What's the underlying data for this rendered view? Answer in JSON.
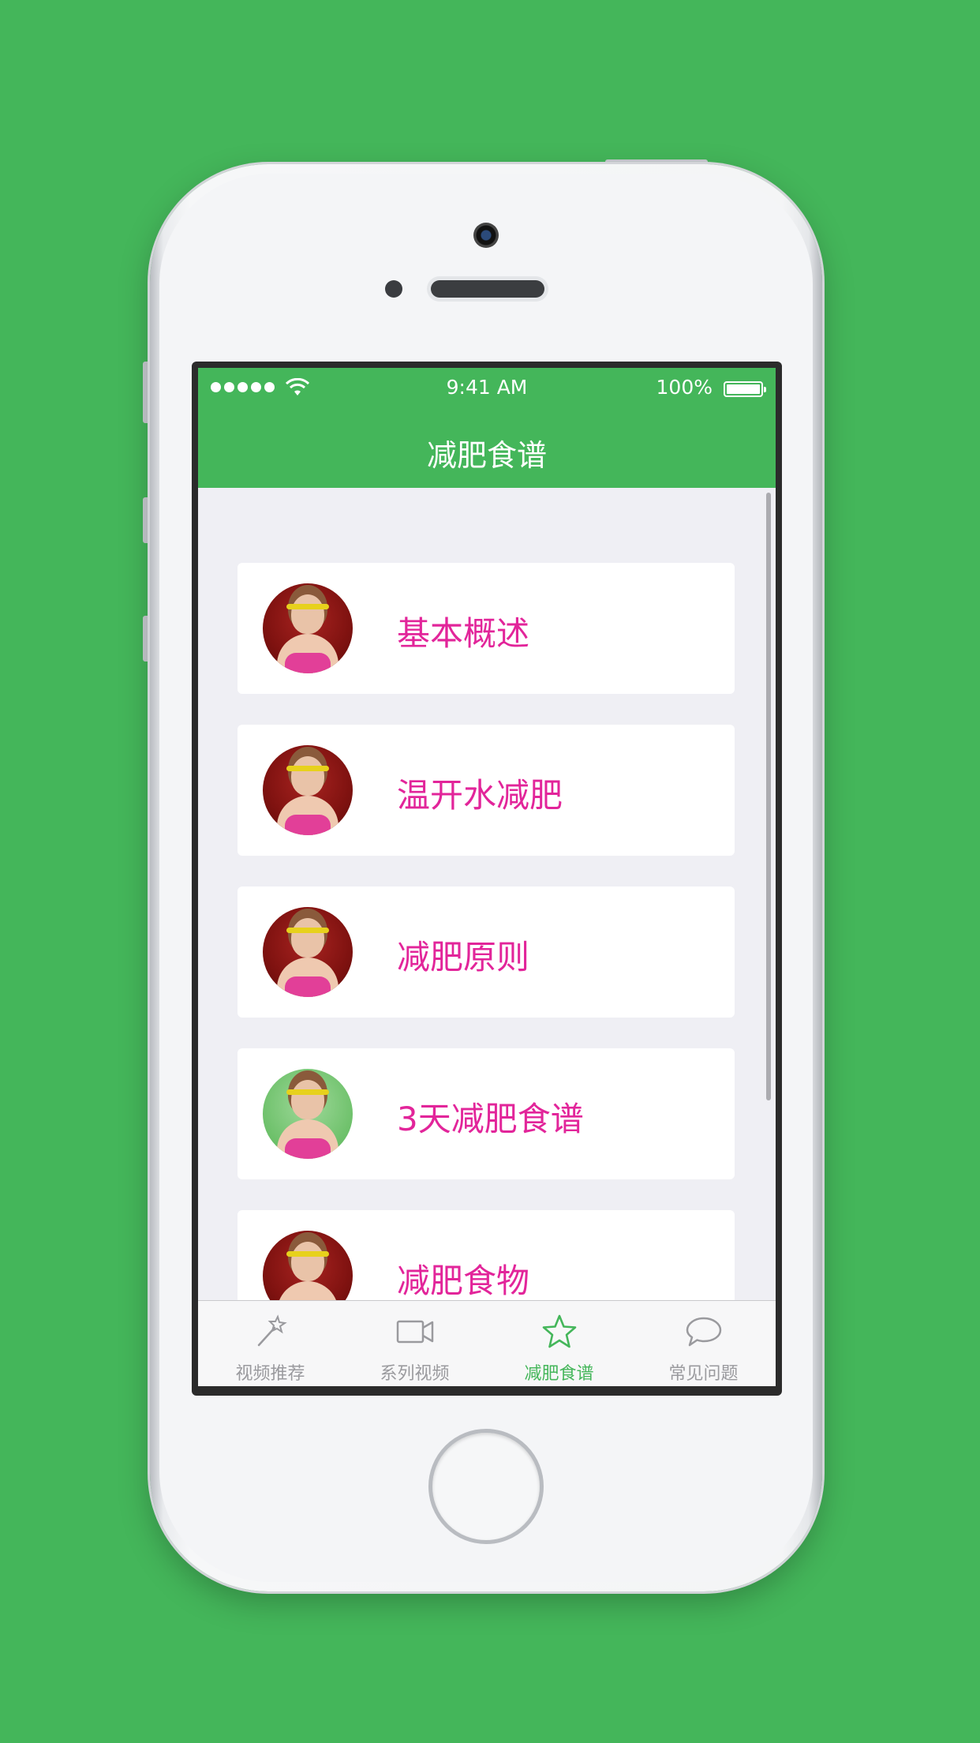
{
  "status_bar": {
    "time": "9:41 AM",
    "battery": "100%"
  },
  "nav": {
    "title": "减肥食谱"
  },
  "items": [
    {
      "label": "基本概述",
      "avatar_bg": "red"
    },
    {
      "label": "温开水减肥",
      "avatar_bg": "red"
    },
    {
      "label": "减肥原则",
      "avatar_bg": "red"
    },
    {
      "label": "3天减肥食谱",
      "avatar_bg": "green"
    },
    {
      "label": "减肥食物",
      "avatar_bg": "red"
    }
  ],
  "tabs": [
    {
      "label": "视频推荐",
      "icon": "magic-wand-icon",
      "active": false
    },
    {
      "label": "系列视频",
      "icon": "video-camera-icon",
      "active": false
    },
    {
      "label": "减肥食谱",
      "icon": "star-icon",
      "active": true
    },
    {
      "label": "常见问题",
      "icon": "chat-bubble-icon",
      "active": false
    }
  ],
  "colors": {
    "background": "#44b65a",
    "accent": "#44b65a",
    "label": "#e2259a",
    "tab_inactive": "#9a9a9e"
  }
}
